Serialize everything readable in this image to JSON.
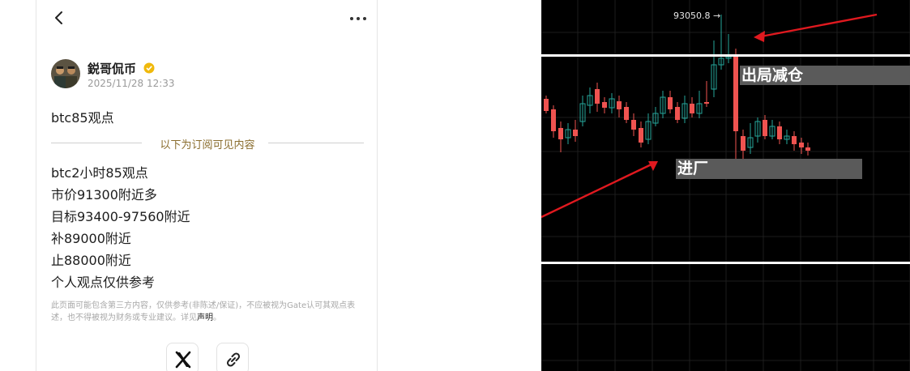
{
  "post": {
    "author_name": "鋭哥侃币",
    "date": "2025/11/28 12:33",
    "headline": "btc85观点",
    "divider_text": "以下为订阅可见内容",
    "lines": [
      "btc2小时85观点",
      "市价91300附近多",
      "目标93400-97560附近",
      "补89000附近",
      "止88000附近",
      "个人观点仅供参考"
    ],
    "disclaimer_part1": "此页面可能包含第三方内容，仅供参考(非陈述/保证)，不应被视为Gate认可其观点表述，也不得被视为财务或专业建议。详见",
    "disclaimer_link": "声明",
    "disclaimer_end": "。"
  },
  "icons": {
    "back": "back-arrow-icon",
    "more": "more-dots-icon",
    "verified": "verified-badge-icon",
    "share_x": "x-logo-icon",
    "share_link": "link-icon"
  },
  "chart": {
    "high_label": "93050.8",
    "label_exit": "出局减仓",
    "label_entry": "进厂",
    "up_color": "#26a69a",
    "down_color": "#ef5350",
    "annotation_color": "#e0191f"
  }
}
